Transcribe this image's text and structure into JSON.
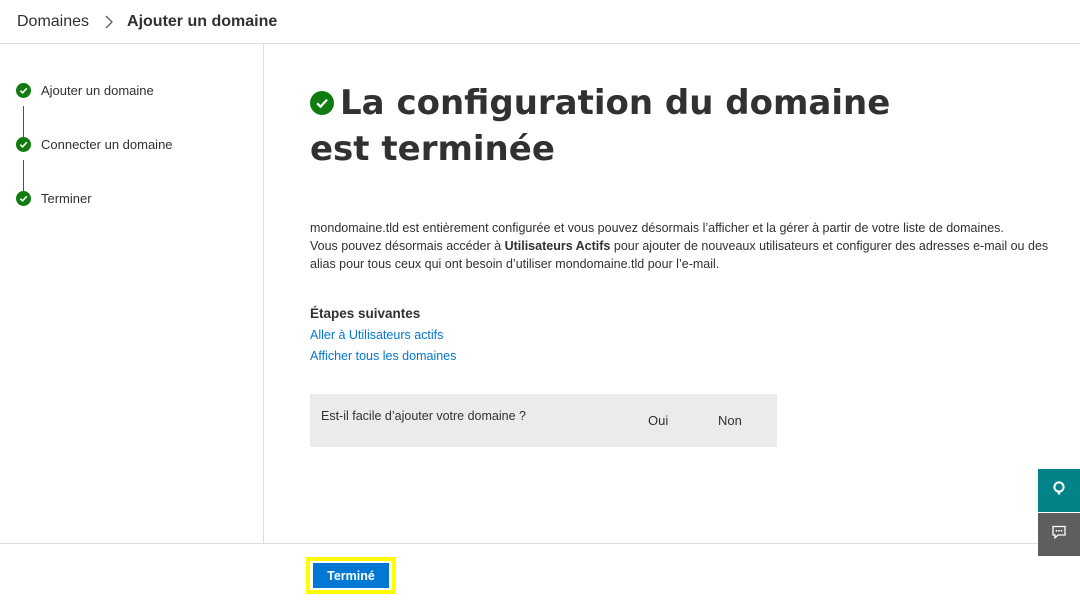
{
  "breadcrumb": {
    "parent": "Domaines",
    "current": "Ajouter un domaine"
  },
  "steps": [
    {
      "label": "Ajouter un domaine",
      "status": "done"
    },
    {
      "label": "Connecter un domaine",
      "status": "done"
    },
    {
      "label": "Terminer",
      "status": "done"
    }
  ],
  "main": {
    "title": "La configuration du domaine est terminée",
    "desc1": "mondomaine.tld est entièrement configurée et vous pouvez désormais l’afficher et la gérer à partir de votre liste de domaines.",
    "desc2_pre": "Vous pouvez désormais accéder à ",
    "desc2_bold": "Utilisateurs Actifs",
    "desc2_post": " pour ajouter de nouveaux utilisateurs et configurer des adresses e-mail ou des alias pour tous ceux qui ont besoin d’utiliser mondomaine.tld pour l’e-mail.",
    "next_title": "Étapes suivantes",
    "link1": "Aller à Utilisateurs actifs",
    "link2": "Afficher tous les domaines"
  },
  "feedback": {
    "question": "Est-il facile d’ajouter votre domaine ?",
    "yes": "Oui",
    "no": "Non"
  },
  "footer": {
    "done": "Terminé"
  },
  "colors": {
    "success": "#107c10",
    "primary": "#0078d4",
    "highlight": "#ffff00",
    "help": "#038387",
    "side_feedback": "#605e5c"
  },
  "icons": {
    "breadcrumb_sep": "chevron-right-icon",
    "step": "check-circle-icon",
    "help": "help-icon",
    "feedback": "chat-feedback-icon"
  }
}
